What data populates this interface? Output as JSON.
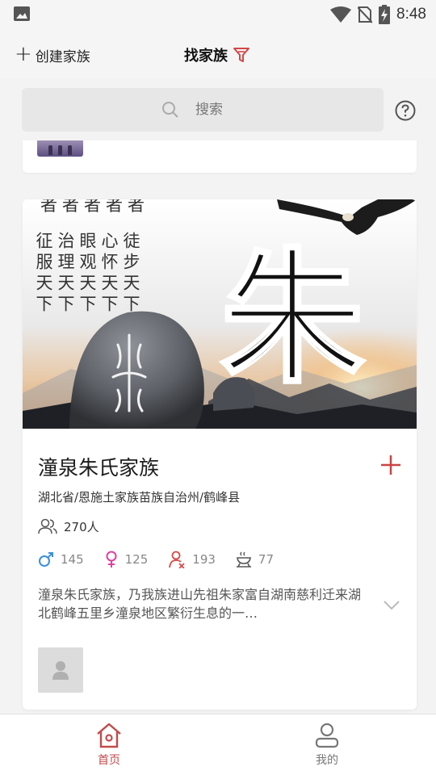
{
  "status_bar": {
    "time": "8:48",
    "icons": [
      "image-icon",
      "wifi-icon",
      "no-sim-icon",
      "battery-charging-icon"
    ]
  },
  "header": {
    "create_label": "创建家族",
    "title": "找家族",
    "filter_icon": "filter-icon"
  },
  "search": {
    "placeholder": "搜索",
    "help_icon": "help-icon"
  },
  "family_card": {
    "name": "潼泉朱氏家族",
    "region": "湖北省/恩施土家族苗族自治州/鹤峰县",
    "members": "270人",
    "stats": {
      "male": "145",
      "female": "125",
      "deceased": "193",
      "ancestor": "77"
    },
    "description": "潼泉朱氏家族，乃我族进山先祖朱家富自湖南慈利迁来湖北鹤峰五里乡潼泉地区繁衍生息的一…",
    "banner": {
      "calligraphy_columns": [
        "征服天下",
        "治理天下",
        "眼观天下",
        "心怀天下",
        "徒步天下"
      ],
      "top_char": "者",
      "big_char": "朱"
    }
  },
  "bottom_nav": {
    "home": "首页",
    "mine": "我的"
  },
  "colors": {
    "accent": "#c24b4b",
    "male": "#3b8fe0",
    "female": "#e040a0",
    "deceased": "#d94a4a"
  }
}
